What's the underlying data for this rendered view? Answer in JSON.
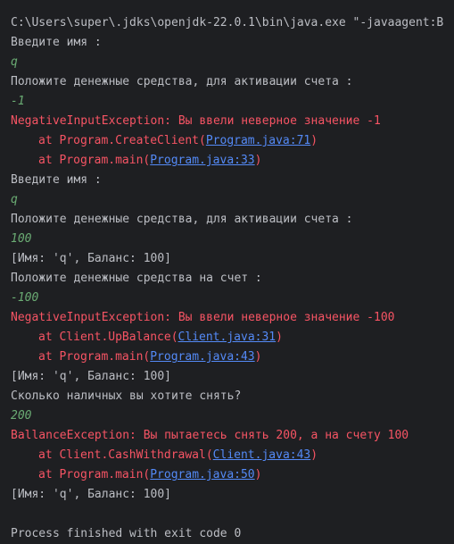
{
  "colors": {
    "background": "#1e1f22",
    "normal_text": "#bcbec4",
    "user_input": "#6aab73",
    "error_text": "#f75464",
    "link": "#548af7"
  },
  "console": {
    "command": "C:\\Users\\super\\.jdks\\openjdk-22.0.1\\bin\\java.exe \"-javaagent:B",
    "prompt_name_1": "Введите имя :",
    "input_name_1": "q",
    "prompt_deposit_1": "Положите денежные средства, для активации счета :",
    "input_deposit_1": "-1",
    "error_1": "NegativeInputException: Вы ввели неверное значение -1",
    "trace_1a": {
      "prefix": "at Program.CreateClient(",
      "link": "Program.java:71",
      "suffix": ")"
    },
    "trace_1b": {
      "prefix": "at Program.main(",
      "link": "Program.java:33",
      "suffix": ")"
    },
    "prompt_name_2": "Введите имя :",
    "input_name_2": "q",
    "prompt_deposit_2": "Положите денежные средства, для активации счета :",
    "input_deposit_2": "100",
    "balance_1": "[Имя: 'q', Баланс: 100]",
    "prompt_topup": "Положите денежные средства на счет :",
    "input_topup": "-100",
    "error_2": "NegativeInputException: Вы ввели неверное значение -100",
    "trace_2a": {
      "prefix": "at Client.UpBalance(",
      "link": "Client.java:31",
      "suffix": ")"
    },
    "trace_2b": {
      "prefix": "at Program.main(",
      "link": "Program.java:43",
      "suffix": ")"
    },
    "balance_2": "[Имя: 'q', Баланс: 100]",
    "prompt_withdraw": "Сколько наличных вы хотите снять?",
    "input_withdraw": "200",
    "error_3": "BallanceException: Вы пытаетесь снять 200, а на счету 100",
    "trace_3a": {
      "prefix": "at Client.CashWithdrawal(",
      "link": "Client.java:43",
      "suffix": ")"
    },
    "trace_3b": {
      "prefix": "at Program.main(",
      "link": "Program.java:50",
      "suffix": ")"
    },
    "balance_3": "[Имя: 'q', Баланс: 100]",
    "exit_message": "Process finished with exit code 0"
  }
}
